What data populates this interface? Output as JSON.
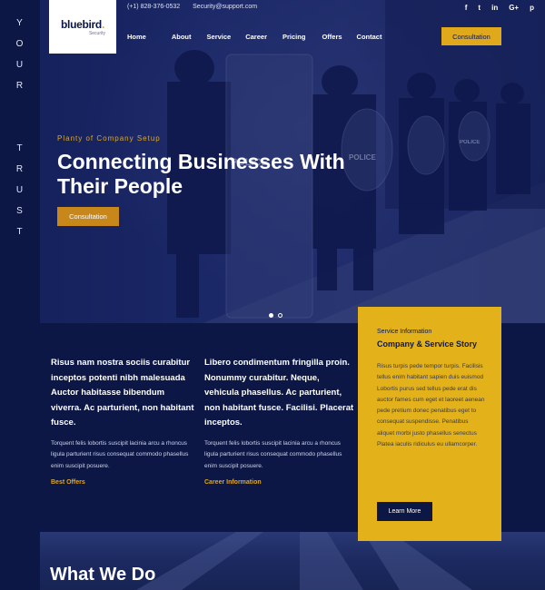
{
  "rail": {
    "letters": [
      "Y",
      "O",
      "U",
      "R",
      "",
      "",
      "T",
      "R",
      "U",
      "S",
      "T"
    ]
  },
  "brand": {
    "name_main": "bluebird",
    "name_dot": ".",
    "tagline": "Security"
  },
  "topbar": {
    "phone": "(+1) 828-376-0532",
    "email": "Security@support.com"
  },
  "social": [
    "f",
    "t",
    "in",
    "G+",
    "p"
  ],
  "nav": [
    "Home",
    "About",
    "Service",
    "Career",
    "Pricing",
    "Offers",
    "Contact"
  ],
  "header_button": "Consultation",
  "hero": {
    "kicker": "Planty of Company Setup",
    "title": "Connecting Businesses With Their People",
    "button": "Consultation"
  },
  "col1": {
    "lead": "Risus nam nostra sociis curabitur inceptos potenti nibh malesuada Auctor habitasse bibendum viverra. Ac parturient, non habitant fusce.",
    "body": "Torquent felis lobortis suscipit lacinia arcu a rhoncus ligula parturient risus consequat commodo phasellus enim suscipit posuere.",
    "link": "Best Offers"
  },
  "col2": {
    "lead": "Libero condimentum fringilla proin. Nonummy curabitur. Neque, vehicula phasellus. Ac parturient, non habitant fusce. Facilisi. Placerat inceptos.",
    "body": "Torquent felis lobortis suscipit lacinia arcu a rhoncus ligula parturient risus consequat commodo phasellus enim suscipit posuere.",
    "link": "Career Information"
  },
  "card": {
    "kicker": "Service Information",
    "title": "Company & Service Story",
    "body": "Risus turpis pede tempor turpis. Facilisis tellus enim habitant sapien duis euismod Lobortis purus sed tellus pede erat dis auctor fames cum eget et laoreet aenean pede pretium donec penatibus eget to consequat suspendisse. Penatibus aliquet morbi justo phasellus senectus Platea iaculis ridiculus eu ullamcorper.",
    "button": "Learn More"
  },
  "section_title": "What We Do",
  "colors": {
    "navy": "#0c1745",
    "gold": "#e0a81b",
    "card_gold": "#e3b21a"
  }
}
